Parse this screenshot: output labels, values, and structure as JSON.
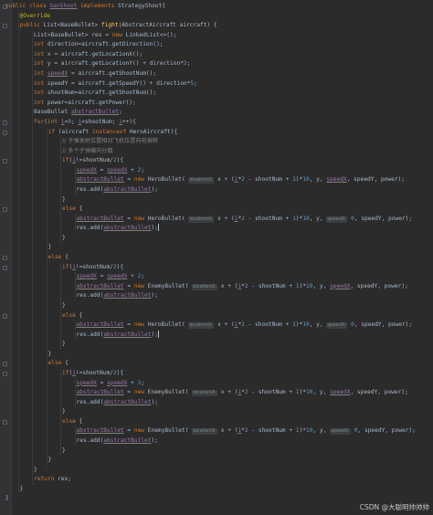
{
  "editor": {
    "lines": [
      {
        "i": 0,
        "fold": true,
        "t": [
          [
            "kw",
            "public class "
          ],
          [
            "u",
            "SanShoot"
          ],
          [
            "kw",
            " implements "
          ],
          [
            "",
            "StrategyShoot{"
          ]
        ]
      },
      {
        "i": 1,
        "t": [
          [
            "ann",
            "@Override"
          ]
        ]
      },
      {
        "i": 1,
        "fold": true,
        "t": [
          [
            "kw",
            "public "
          ],
          [
            "",
            "List<BaseBullet> "
          ],
          [
            "fn",
            "fight"
          ],
          [
            "",
            "(AbstractAircraft aircraft) {"
          ]
        ]
      },
      {
        "i": 2,
        "t": [
          [
            "",
            "List<BaseBullet> res = "
          ],
          [
            "kw",
            "new "
          ],
          [
            "",
            "LinkedList<>();"
          ]
        ]
      },
      {
        "i": 2,
        "t": [
          [
            "kw",
            "int "
          ],
          [
            "",
            "direction=aircraft.getDirection();"
          ]
        ]
      },
      {
        "i": 2,
        "t": [
          [
            "kw",
            "int "
          ],
          [
            "",
            "x = aircraft.getLocationX();"
          ]
        ]
      },
      {
        "i": 2,
        "t": [
          [
            "kw",
            "int "
          ],
          [
            "",
            "y = aircraft.getLocationY() + direction*"
          ],
          [
            "num",
            "2"
          ],
          [
            "",
            ";"
          ]
        ]
      },
      {
        "i": 2,
        "t": [
          [
            "kw",
            "int "
          ],
          [
            "u",
            "speedX"
          ],
          [
            "",
            " = aircraft.getShootNum();"
          ]
        ]
      },
      {
        "i": 2,
        "t": [
          [
            "kw",
            "int "
          ],
          [
            "",
            "speedY = aircraft.getSpeedY() + direction*"
          ],
          [
            "num",
            "5"
          ],
          [
            "",
            ";"
          ]
        ]
      },
      {
        "i": 2,
        "t": [
          [
            "kw",
            "int "
          ],
          [
            "",
            "shootNum=aircraft.getShootNum();"
          ]
        ]
      },
      {
        "i": 2,
        "t": [
          [
            "kw",
            "int "
          ],
          [
            "",
            "power=aircraft.getPower();"
          ]
        ]
      },
      {
        "i": 2,
        "t": [
          [
            "",
            "BaseBullet "
          ],
          [
            "u",
            "abstractBullet"
          ],
          [
            "",
            ";"
          ]
        ]
      },
      {
        "i": 2,
        "fold": true,
        "t": [
          [
            "kw",
            "for"
          ],
          [
            "",
            "("
          ],
          [
            "kw",
            "int "
          ],
          [
            "u",
            "i"
          ],
          [
            "",
            "="
          ],
          [
            "num",
            "0"
          ],
          [
            "",
            "; "
          ],
          [
            "u",
            "i"
          ],
          [
            "",
            "<shootNum; "
          ],
          [
            "u",
            "i"
          ],
          [
            "",
            "++){"
          ]
        ]
      },
      {
        "i": 3,
        "fold": true,
        "t": [
          [
            "kw",
            "if "
          ],
          [
            "",
            "(aircraft "
          ],
          [
            "kw",
            "instanceof "
          ],
          [
            "",
            "HeroAircraft){"
          ]
        ]
      },
      {
        "i": 4,
        "t": [
          [
            "cmt",
            "// 子弹发射位置相对飞机位置向前偏移"
          ]
        ]
      },
      {
        "i": 4,
        "t": [
          [
            "cmt",
            "// 多个子弹横向分散"
          ]
        ]
      },
      {
        "i": 4,
        "fold": true,
        "t": [
          [
            "kw",
            "if"
          ],
          [
            "",
            "("
          ],
          [
            "u",
            "i"
          ],
          [
            "",
            "!=shootNum/"
          ],
          [
            "num",
            "2"
          ],
          [
            "",
            "){"
          ]
        ]
      },
      {
        "i": 5,
        "t": [
          [
            "u",
            "speedX"
          ],
          [
            "",
            " = "
          ],
          [
            "u",
            "speedX"
          ],
          [
            "",
            " + "
          ],
          [
            "num",
            "2"
          ],
          [
            "",
            ";"
          ]
        ]
      },
      {
        "i": 5,
        "t": [
          [
            "u",
            "abstractBullet"
          ],
          [
            "",
            " = "
          ],
          [
            "kw",
            "new "
          ],
          [
            "",
            "HeroBullet( "
          ],
          [
            "hint",
            "locationX:"
          ],
          [
            "",
            " x + ("
          ],
          [
            "u",
            "i"
          ],
          [
            "",
            "*"
          ],
          [
            "num",
            "2"
          ],
          [
            "",
            " - shootNum + "
          ],
          [
            "num",
            "1"
          ],
          [
            "",
            ")*"
          ],
          [
            "num",
            "10"
          ],
          [
            "",
            ", y, "
          ],
          [
            "u",
            "speedX"
          ],
          [
            "",
            ", speedY, power);"
          ]
        ]
      },
      {
        "i": 5,
        "t": [
          [
            "",
            "res.add("
          ],
          [
            "u",
            "abstractBullet"
          ],
          [
            "",
            ");"
          ]
        ]
      },
      {
        "i": 4,
        "t": [
          [
            "",
            "}"
          ]
        ]
      },
      {
        "i": 4,
        "fold": true,
        "t": [
          [
            "kw",
            "else "
          ],
          [
            "",
            "{"
          ]
        ]
      },
      {
        "i": 5,
        "t": [
          [
            "u",
            "abstractBullet"
          ],
          [
            "",
            " = "
          ],
          [
            "kw",
            "new "
          ],
          [
            "",
            "HeroBullet( "
          ],
          [
            "hint",
            "locationX:"
          ],
          [
            "",
            " x + ("
          ],
          [
            "u",
            "i"
          ],
          [
            "",
            "*"
          ],
          [
            "num",
            "2"
          ],
          [
            "",
            " - shootNum + "
          ],
          [
            "num",
            "1"
          ],
          [
            "",
            ")*"
          ],
          [
            "num",
            "10"
          ],
          [
            "",
            ", y, "
          ],
          [
            "hint",
            "speedX:"
          ],
          [
            "",
            " "
          ],
          [
            "num",
            "0"
          ],
          [
            "",
            ", speedY, power);"
          ]
        ]
      },
      {
        "i": 5,
        "caret": true,
        "t": [
          [
            "",
            "res.add("
          ],
          [
            "u",
            "abstractBullet"
          ],
          [
            "",
            ");"
          ]
        ]
      },
      {
        "i": 4,
        "t": [
          [
            "",
            "}"
          ]
        ]
      },
      {
        "i": 3,
        "t": [
          [
            "",
            "}"
          ]
        ]
      },
      {
        "i": 3,
        "fold": true,
        "t": [
          [
            "kw",
            "else "
          ],
          [
            "",
            "{"
          ]
        ]
      },
      {
        "i": 4,
        "fold": true,
        "t": [
          [
            "kw",
            "if"
          ],
          [
            "",
            "("
          ],
          [
            "u",
            "i"
          ],
          [
            "",
            "!=shootNum/"
          ],
          [
            "num",
            "2"
          ],
          [
            "",
            "){"
          ]
        ]
      },
      {
        "i": 5,
        "t": [
          [
            "u",
            "speedX"
          ],
          [
            "",
            " = "
          ],
          [
            "u",
            "speedX"
          ],
          [
            "",
            " + "
          ],
          [
            "num",
            "2"
          ],
          [
            "",
            ";"
          ]
        ]
      },
      {
        "i": 5,
        "t": [
          [
            "u",
            "abstractBullet"
          ],
          [
            "",
            " = "
          ],
          [
            "kw",
            "new "
          ],
          [
            "",
            "EnemyBullet( "
          ],
          [
            "hint",
            "locationX:"
          ],
          [
            "",
            " x + ("
          ],
          [
            "u",
            "i"
          ],
          [
            "",
            "*"
          ],
          [
            "num",
            "2"
          ],
          [
            "",
            " - shootNum + "
          ],
          [
            "num",
            "1"
          ],
          [
            "",
            ")*"
          ],
          [
            "num",
            "10"
          ],
          [
            "",
            ", y, "
          ],
          [
            "u",
            "speedX"
          ],
          [
            "",
            ", speedY, power);"
          ]
        ]
      },
      {
        "i": 5,
        "t": [
          [
            "",
            "res.add("
          ],
          [
            "u",
            "abstractBullet"
          ],
          [
            "",
            ");"
          ]
        ]
      },
      {
        "i": 4,
        "t": [
          [
            "",
            "}"
          ]
        ]
      },
      {
        "i": 4,
        "fold": true,
        "t": [
          [
            "kw",
            "else "
          ],
          [
            "",
            "{"
          ]
        ]
      },
      {
        "i": 5,
        "t": [
          [
            "u",
            "abstractBullet"
          ],
          [
            "",
            " = "
          ],
          [
            "kw",
            "new "
          ],
          [
            "",
            "HeroBullet( "
          ],
          [
            "hint",
            "locationX:"
          ],
          [
            "",
            " x + ("
          ],
          [
            "u",
            "i"
          ],
          [
            "",
            "*"
          ],
          [
            "num",
            "2"
          ],
          [
            "",
            " - shootNum + "
          ],
          [
            "num",
            "1"
          ],
          [
            "",
            ")*"
          ],
          [
            "num",
            "10"
          ],
          [
            "",
            ", y, "
          ],
          [
            "hint",
            "speedX:"
          ],
          [
            "",
            " "
          ],
          [
            "num",
            "0"
          ],
          [
            "",
            ", speedY, power);"
          ]
        ]
      },
      {
        "i": 5,
        "caret": true,
        "t": [
          [
            "",
            "res.add("
          ],
          [
            "u",
            "abstractBullet"
          ],
          [
            "",
            ");"
          ]
        ]
      },
      {
        "i": 4,
        "t": [
          [
            "",
            "}"
          ]
        ]
      },
      {
        "i": 3,
        "t": [
          [
            "",
            "}"
          ]
        ]
      },
      {
        "i": 3,
        "fold": true,
        "t": [
          [
            "kw",
            "else "
          ],
          [
            "",
            "{"
          ]
        ]
      },
      {
        "i": 4,
        "fold": true,
        "t": [
          [
            "kw",
            "if"
          ],
          [
            "",
            "("
          ],
          [
            "u",
            "i"
          ],
          [
            "",
            "!=shootNum/"
          ],
          [
            "num",
            "2"
          ],
          [
            "",
            "){"
          ]
        ]
      },
      {
        "i": 5,
        "t": [
          [
            "u",
            "speedX"
          ],
          [
            "",
            " = "
          ],
          [
            "u",
            "speedX"
          ],
          [
            "",
            " + "
          ],
          [
            "num",
            "2"
          ],
          [
            "",
            ";"
          ]
        ]
      },
      {
        "i": 5,
        "t": [
          [
            "u",
            "abstractBullet"
          ],
          [
            "",
            " = "
          ],
          [
            "kw",
            "new "
          ],
          [
            "",
            "EnemyBullet( "
          ],
          [
            "hint",
            "locationX:"
          ],
          [
            "",
            " x + ("
          ],
          [
            "u",
            "i"
          ],
          [
            "",
            "*"
          ],
          [
            "num",
            "2"
          ],
          [
            "",
            " - shootNum + "
          ],
          [
            "num",
            "1"
          ],
          [
            "",
            ")*"
          ],
          [
            "num",
            "10"
          ],
          [
            "",
            ", y, "
          ],
          [
            "u",
            "speedX"
          ],
          [
            "",
            ", speedY, power);"
          ]
        ]
      },
      {
        "i": 5,
        "t": [
          [
            "",
            "res.add("
          ],
          [
            "u",
            "abstractBullet"
          ],
          [
            "",
            ");"
          ]
        ]
      },
      {
        "i": 4,
        "t": [
          [
            "",
            "}"
          ]
        ]
      },
      {
        "i": 4,
        "fold": true,
        "t": [
          [
            "kw",
            "else "
          ],
          [
            "",
            "{"
          ]
        ]
      },
      {
        "i": 5,
        "t": [
          [
            "u",
            "abstractBullet"
          ],
          [
            "",
            " = "
          ],
          [
            "kw",
            "new "
          ],
          [
            "",
            "EnemyBullet( "
          ],
          [
            "hint",
            "locationX:"
          ],
          [
            "",
            " x + ("
          ],
          [
            "u",
            "i"
          ],
          [
            "",
            "*"
          ],
          [
            "num",
            "2"
          ],
          [
            "",
            " - shootNum + "
          ],
          [
            "num",
            "1"
          ],
          [
            "",
            ")*"
          ],
          [
            "num",
            "10"
          ],
          [
            "",
            ", y, "
          ],
          [
            "hint",
            "speedX:"
          ],
          [
            "",
            " "
          ],
          [
            "num",
            "0"
          ],
          [
            "",
            ", speedY, power);"
          ]
        ]
      },
      {
        "i": 5,
        "t": [
          [
            "",
            "res.add("
          ],
          [
            "u",
            "abstractBullet"
          ],
          [
            "",
            ");"
          ]
        ]
      },
      {
        "i": 4,
        "t": [
          [
            "",
            "}"
          ]
        ]
      },
      {
        "i": 3,
        "t": [
          [
            "",
            "}"
          ]
        ]
      },
      {
        "i": 2,
        "t": [
          [
            "",
            "}"
          ]
        ]
      },
      {
        "i": 2,
        "t": [
          [
            "kw",
            "return "
          ],
          [
            "",
            "res;"
          ]
        ]
      },
      {
        "i": 1,
        "t": [
          [
            "",
            "}"
          ]
        ]
      },
      {
        "i": 0,
        "t": [
          [
            "",
            "}"
          ]
        ]
      }
    ]
  },
  "watermark": "CSDN @大聪明帅帅帅"
}
